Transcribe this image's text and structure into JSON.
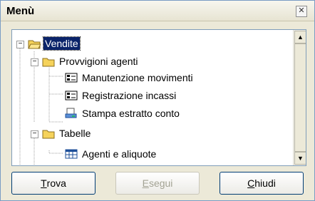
{
  "window": {
    "title": "Menù",
    "close_icon": "close-icon"
  },
  "tree": {
    "nodes": [
      {
        "id": "vendite",
        "label": "Vendite",
        "icon": "folder-open-icon",
        "selected": true
      },
      {
        "id": "provvigioni",
        "label": "Provvigioni agenti",
        "icon": "folder-open-icon"
      },
      {
        "id": "manutenzione",
        "label": "Manutenzione movimenti",
        "icon": "form-icon"
      },
      {
        "id": "registrazione",
        "label": "Registrazione incassi",
        "icon": "form-icon"
      },
      {
        "id": "stampa",
        "label": "Stampa estratto conto",
        "icon": "print-icon"
      },
      {
        "id": "tabelle",
        "label": "Tabelle",
        "icon": "folder-open-icon"
      },
      {
        "id": "agenti",
        "label": "Agenti e aliquote",
        "icon": "table-icon"
      }
    ],
    "expander_collapse": "−"
  },
  "buttons": {
    "trova": {
      "mnemonic": "T",
      "rest": "rova"
    },
    "esegui": {
      "mnemonic": "E",
      "rest": "segui"
    },
    "chiudi": {
      "mnemonic": "C",
      "rest": "hiudi"
    }
  },
  "colors": {
    "selection": "#0a246a",
    "folder": "#f5d25a"
  }
}
